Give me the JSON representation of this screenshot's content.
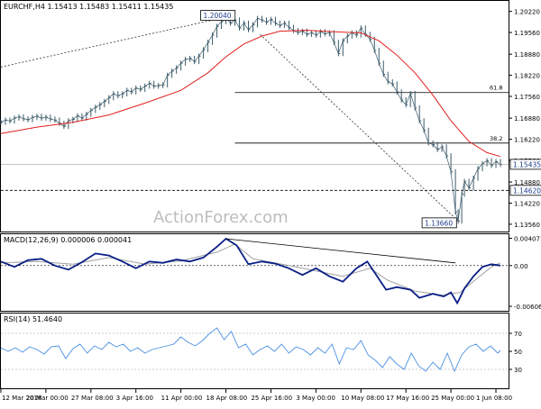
{
  "chart_data": {
    "type": "line",
    "main": {
      "header_text": "EURCHF,H4  1.15413 1.15483 1.15411 1.15435",
      "ylim": [
        1.1336,
        1.2052
      ],
      "y_ticks": [
        "1.20220",
        "1.19560",
        "1.18880",
        "1.18220",
        "1.17560",
        "1.16880",
        "1.16220",
        "1.15560",
        "1.14880",
        "1.14220",
        "1.13560"
      ],
      "y_tick_values": [
        1.2022,
        1.1956,
        1.1888,
        1.1822,
        1.1756,
        1.1688,
        1.1622,
        1.1556,
        1.1488,
        1.1422,
        1.1356
      ],
      "price_series": [
        [
          0,
          1.1675
        ],
        [
          5,
          1.1682
        ],
        [
          10,
          1.1679
        ],
        [
          15,
          1.1688
        ],
        [
          20,
          1.1692
        ],
        [
          25,
          1.1686
        ],
        [
          30,
          1.1683
        ],
        [
          35,
          1.169
        ],
        [
          40,
          1.1694
        ],
        [
          45,
          1.1688
        ],
        [
          50,
          1.1691
        ],
        [
          55,
          1.1685
        ],
        [
          60,
          1.1682
        ],
        [
          65,
          1.1672
        ],
        [
          70,
          1.1662
        ],
        [
          75,
          1.168
        ],
        [
          80,
          1.1684
        ],
        [
          85,
          1.1695
        ],
        [
          90,
          1.1688
        ],
        [
          95,
          1.17
        ],
        [
          100,
          1.1712
        ],
        [
          105,
          1.1722
        ],
        [
          110,
          1.173
        ],
        [
          115,
          1.174
        ],
        [
          120,
          1.1752
        ],
        [
          125,
          1.1764
        ],
        [
          130,
          1.1758
        ],
        [
          135,
          1.1764
        ],
        [
          140,
          1.1775
        ],
        [
          145,
          1.177
        ],
        [
          150,
          1.1782
        ],
        [
          155,
          1.1778
        ],
        [
          160,
          1.1788
        ],
        [
          165,
          1.1797
        ],
        [
          170,
          1.1788
        ],
        [
          175,
          1.179
        ],
        [
          180,
          1.1792
        ],
        [
          185,
          1.1822
        ],
        [
          190,
          1.1835
        ],
        [
          195,
          1.1845
        ],
        [
          200,
          1.186
        ],
        [
          205,
          1.1872
        ],
        [
          210,
          1.1875
        ],
        [
          215,
          1.1865
        ],
        [
          220,
          1.1882
        ],
        [
          225,
          1.1902
        ],
        [
          230,
          1.1925
        ],
        [
          235,
          1.1948
        ],
        [
          240,
          1.1975
        ],
        [
          245,
          1.199
        ],
        [
          250,
          1.2004
        ],
        [
          255,
          1.1985
        ],
        [
          260,
          1.1995
        ],
        [
          265,
          1.197
        ],
        [
          270,
          1.1985
        ],
        [
          275,
          1.1965
        ],
        [
          280,
          1.198
        ],
        [
          285,
          1.2
        ],
        [
          290,
          1.1995
        ],
        [
          295,
          1.1988
        ],
        [
          300,
          1.1997
        ],
        [
          305,
          1.1985
        ],
        [
          310,
          1.1978
        ],
        [
          315,
          1.1985
        ],
        [
          320,
          1.1972
        ],
        [
          325,
          1.1962
        ],
        [
          330,
          1.1956
        ],
        [
          335,
          1.196
        ],
        [
          340,
          1.195
        ],
        [
          345,
          1.1955
        ],
        [
          350,
          1.1948
        ],
        [
          355,
          1.1958
        ],
        [
          360,
          1.1952
        ],
        [
          365,
          1.1955
        ],
        [
          370,
          1.1925
        ],
        [
          375,
          1.189
        ],
        [
          380,
          1.193
        ],
        [
          385,
          1.1945
        ],
        [
          390,
          1.1955
        ],
        [
          395,
          1.1948
        ],
        [
          400,
          1.197
        ],
        [
          405,
          1.195
        ],
        [
          410,
          1.1935
        ],
        [
          415,
          1.19
        ],
        [
          420,
          1.186
        ],
        [
          425,
          1.1825
        ],
        [
          430,
          1.1802
        ],
        [
          435,
          1.1795
        ],
        [
          440,
          1.177
        ],
        [
          445,
          1.1745
        ],
        [
          450,
          1.173
        ],
        [
          455,
          1.1765
        ],
        [
          460,
          1.172
        ],
        [
          465,
          1.168
        ],
        [
          470,
          1.165
        ],
        [
          475,
          1.161
        ],
        [
          480,
          1.1605
        ],
        [
          485,
          1.159
        ],
        [
          490,
          1.1598
        ],
        [
          495,
          1.157
        ],
        [
          500,
          1.152
        ],
        [
          505,
          1.1395
        ],
        [
          508,
          1.1366
        ],
        [
          512,
          1.145
        ],
        [
          515,
          1.149
        ],
        [
          520,
          1.147
        ],
        [
          525,
          1.15
        ],
        [
          530,
          1.153
        ],
        [
          535,
          1.1545
        ],
        [
          540,
          1.1555
        ],
        [
          545,
          1.154
        ],
        [
          550,
          1.1552
        ],
        [
          555,
          1.1543
        ]
      ],
      "ma_series": [
        [
          0,
          1.164
        ],
        [
          40,
          1.166
        ],
        [
          80,
          1.1675
        ],
        [
          120,
          1.1698
        ],
        [
          160,
          1.1735
        ],
        [
          200,
          1.1775
        ],
        [
          230,
          1.183
        ],
        [
          250,
          1.188
        ],
        [
          270,
          1.192
        ],
        [
          290,
          1.1945
        ],
        [
          310,
          1.196
        ],
        [
          340,
          1.1963
        ],
        [
          370,
          1.1958
        ],
        [
          400,
          1.1955
        ],
        [
          420,
          1.193
        ],
        [
          440,
          1.1885
        ],
        [
          460,
          1.183
        ],
        [
          480,
          1.176
        ],
        [
          500,
          1.168
        ],
        [
          520,
          1.1615
        ],
        [
          540,
          1.158
        ],
        [
          555,
          1.1568
        ]
      ],
      "hlines": [
        {
          "y": 1.1768,
          "label": "61.8",
          "style": "solid",
          "x0": 260
        },
        {
          "y": 1.161,
          "label": "38.2",
          "style": "solid",
          "x0": 260
        },
        {
          "y": 1.1462,
          "label": "1.14620",
          "style": "dashed",
          "x0": 0
        }
      ],
      "trendline_up": [
        [
          0,
          1.1848
        ],
        [
          250,
          1.2004
        ]
      ],
      "trendline_down": [
        [
          288,
          1.195
        ],
        [
          508,
          1.1366
        ]
      ],
      "annotation_high": {
        "text": "1.20040",
        "x": 250,
        "y": 1.2004
      },
      "annotation_low": {
        "text": "1.13660",
        "x": 508,
        "y": 1.1366
      },
      "current_price": {
        "text": "1.15435",
        "y": 1.15435
      },
      "watermark": "ActionForex.com"
    },
    "macd": {
      "header_text": "MACD(12,26,9) 0.000006 0.000041",
      "ylim": [
        -0.0066,
        0.0044
      ],
      "y_ticks": [
        "0.004071",
        "0.00",
        "-0.006069"
      ],
      "y_tick_values": [
        0.004071,
        0.0,
        -0.006069
      ],
      "macd_series": [
        [
          0,
          0.0006
        ],
        [
          15,
          -0.0002
        ],
        [
          30,
          0.0008
        ],
        [
          45,
          0.001
        ],
        [
          60,
          0.0
        ],
        [
          75,
          -0.0006
        ],
        [
          90,
          0.0005
        ],
        [
          105,
          0.0018
        ],
        [
          120,
          0.0015
        ],
        [
          135,
          0.0006
        ],
        [
          150,
          -0.0004
        ],
        [
          165,
          0.0006
        ],
        [
          180,
          0.0004
        ],
        [
          195,
          0.0009
        ],
        [
          210,
          0.0006
        ],
        [
          225,
          0.0012
        ],
        [
          240,
          0.0028
        ],
        [
          250,
          0.004
        ],
        [
          262,
          0.003
        ],
        [
          275,
          0.0002
        ],
        [
          290,
          0.0006
        ],
        [
          305,
          0.0003
        ],
        [
          320,
          -0.0004
        ],
        [
          335,
          -0.0014
        ],
        [
          350,
          -0.0004
        ],
        [
          365,
          -0.0016
        ],
        [
          380,
          -0.0024
        ],
        [
          395,
          -0.0004
        ],
        [
          407,
          0.0006
        ],
        [
          418,
          -0.0016
        ],
        [
          428,
          -0.0036
        ],
        [
          440,
          -0.0032
        ],
        [
          455,
          -0.0036
        ],
        [
          465,
          -0.0048
        ],
        [
          480,
          -0.0042
        ],
        [
          492,
          -0.0046
        ],
        [
          500,
          -0.004
        ],
        [
          507,
          -0.0056
        ],
        [
          515,
          -0.0034
        ],
        [
          525,
          -0.0016
        ],
        [
          535,
          -0.0002
        ],
        [
          545,
          0.0002
        ],
        [
          555,
          0.0
        ]
      ],
      "signal_series": [
        [
          0,
          0.0004
        ],
        [
          40,
          0.0006
        ],
        [
          80,
          0.0002
        ],
        [
          120,
          0.0012
        ],
        [
          160,
          0.0002
        ],
        [
          200,
          0.0007
        ],
        [
          240,
          0.002
        ],
        [
          260,
          0.0032
        ],
        [
          280,
          0.001
        ],
        [
          320,
          0.0
        ],
        [
          350,
          -0.0008
        ],
        [
          380,
          -0.0016
        ],
        [
          410,
          -0.0004
        ],
        [
          430,
          -0.0022
        ],
        [
          460,
          -0.0038
        ],
        [
          490,
          -0.0044
        ],
        [
          510,
          -0.004
        ],
        [
          530,
          -0.0018
        ],
        [
          545,
          -0.0002
        ],
        [
          555,
          0.0004
        ]
      ],
      "trendline": [
        [
          250,
          0.004
        ],
        [
          505,
          0.0004
        ]
      ]
    },
    "rsi": {
      "header_text": "RSI(14) 51.4640",
      "ylim": [
        10,
        90
      ],
      "y_ticks": [
        "70",
        "50",
        "30"
      ],
      "y_tick_values": [
        70,
        50,
        30
      ],
      "rsi_series": [
        [
          0,
          54
        ],
        [
          8,
          50
        ],
        [
          16,
          54
        ],
        [
          24,
          49
        ],
        [
          32,
          55
        ],
        [
          40,
          52
        ],
        [
          48,
          47
        ],
        [
          56,
          55
        ],
        [
          64,
          56
        ],
        [
          72,
          42
        ],
        [
          80,
          53
        ],
        [
          88,
          58
        ],
        [
          96,
          48
        ],
        [
          104,
          56
        ],
        [
          112,
          52
        ],
        [
          120,
          60
        ],
        [
          128,
          55
        ],
        [
          136,
          58
        ],
        [
          144,
          50
        ],
        [
          152,
          54
        ],
        [
          160,
          48
        ],
        [
          168,
          52
        ],
        [
          176,
          54
        ],
        [
          184,
          56
        ],
        [
          192,
          58
        ],
        [
          200,
          66
        ],
        [
          208,
          60
        ],
        [
          216,
          56
        ],
        [
          224,
          62
        ],
        [
          232,
          70
        ],
        [
          240,
          76
        ],
        [
          248,
          63
        ],
        [
          256,
          72
        ],
        [
          264,
          54
        ],
        [
          272,
          58
        ],
        [
          280,
          46
        ],
        [
          288,
          52
        ],
        [
          296,
          56
        ],
        [
          304,
          50
        ],
        [
          312,
          58
        ],
        [
          320,
          48
        ],
        [
          328,
          55
        ],
        [
          336,
          52
        ],
        [
          344,
          46
        ],
        [
          352,
          54
        ],
        [
          360,
          48
        ],
        [
          368,
          58
        ],
        [
          376,
          36
        ],
        [
          384,
          54
        ],
        [
          392,
          52
        ],
        [
          400,
          62
        ],
        [
          408,
          46
        ],
        [
          416,
          40
        ],
        [
          424,
          32
        ],
        [
          432,
          44
        ],
        [
          440,
          36
        ],
        [
          448,
          30
        ],
        [
          456,
          48
        ],
        [
          464,
          34
        ],
        [
          472,
          28
        ],
        [
          480,
          38
        ],
        [
          488,
          30
        ],
        [
          496,
          48
        ],
        [
          504,
          28
        ],
        [
          512,
          46
        ],
        [
          520,
          55
        ],
        [
          528,
          58
        ],
        [
          536,
          50
        ],
        [
          544,
          56
        ],
        [
          552,
          48
        ],
        [
          555,
          51
        ]
      ]
    },
    "x_ticks": [
      "12 Mar 2018",
      "20 Mar 00:00",
      "27 Mar 08:00",
      "3 Apr 16:00",
      "11 Apr 00:00",
      "18 Apr 08:00",
      "25 Apr 16:00",
      "3 May 00:00",
      "10 May 08:00",
      "17 May 16:00",
      "25 May 00:00",
      "1 Jun 08:00"
    ],
    "x_tick_positions": [
      0,
      50,
      100,
      150,
      200,
      250,
      300,
      350,
      400,
      450,
      500,
      550
    ],
    "colors": {
      "price": "#3b5a6a",
      "ma": "#e0201e",
      "macd": "#0a1e86",
      "signal": "#a0a0a0",
      "rsi": "#4a90e2",
      "grid_line": "#000000",
      "label_bg": "#ffffff"
    }
  }
}
